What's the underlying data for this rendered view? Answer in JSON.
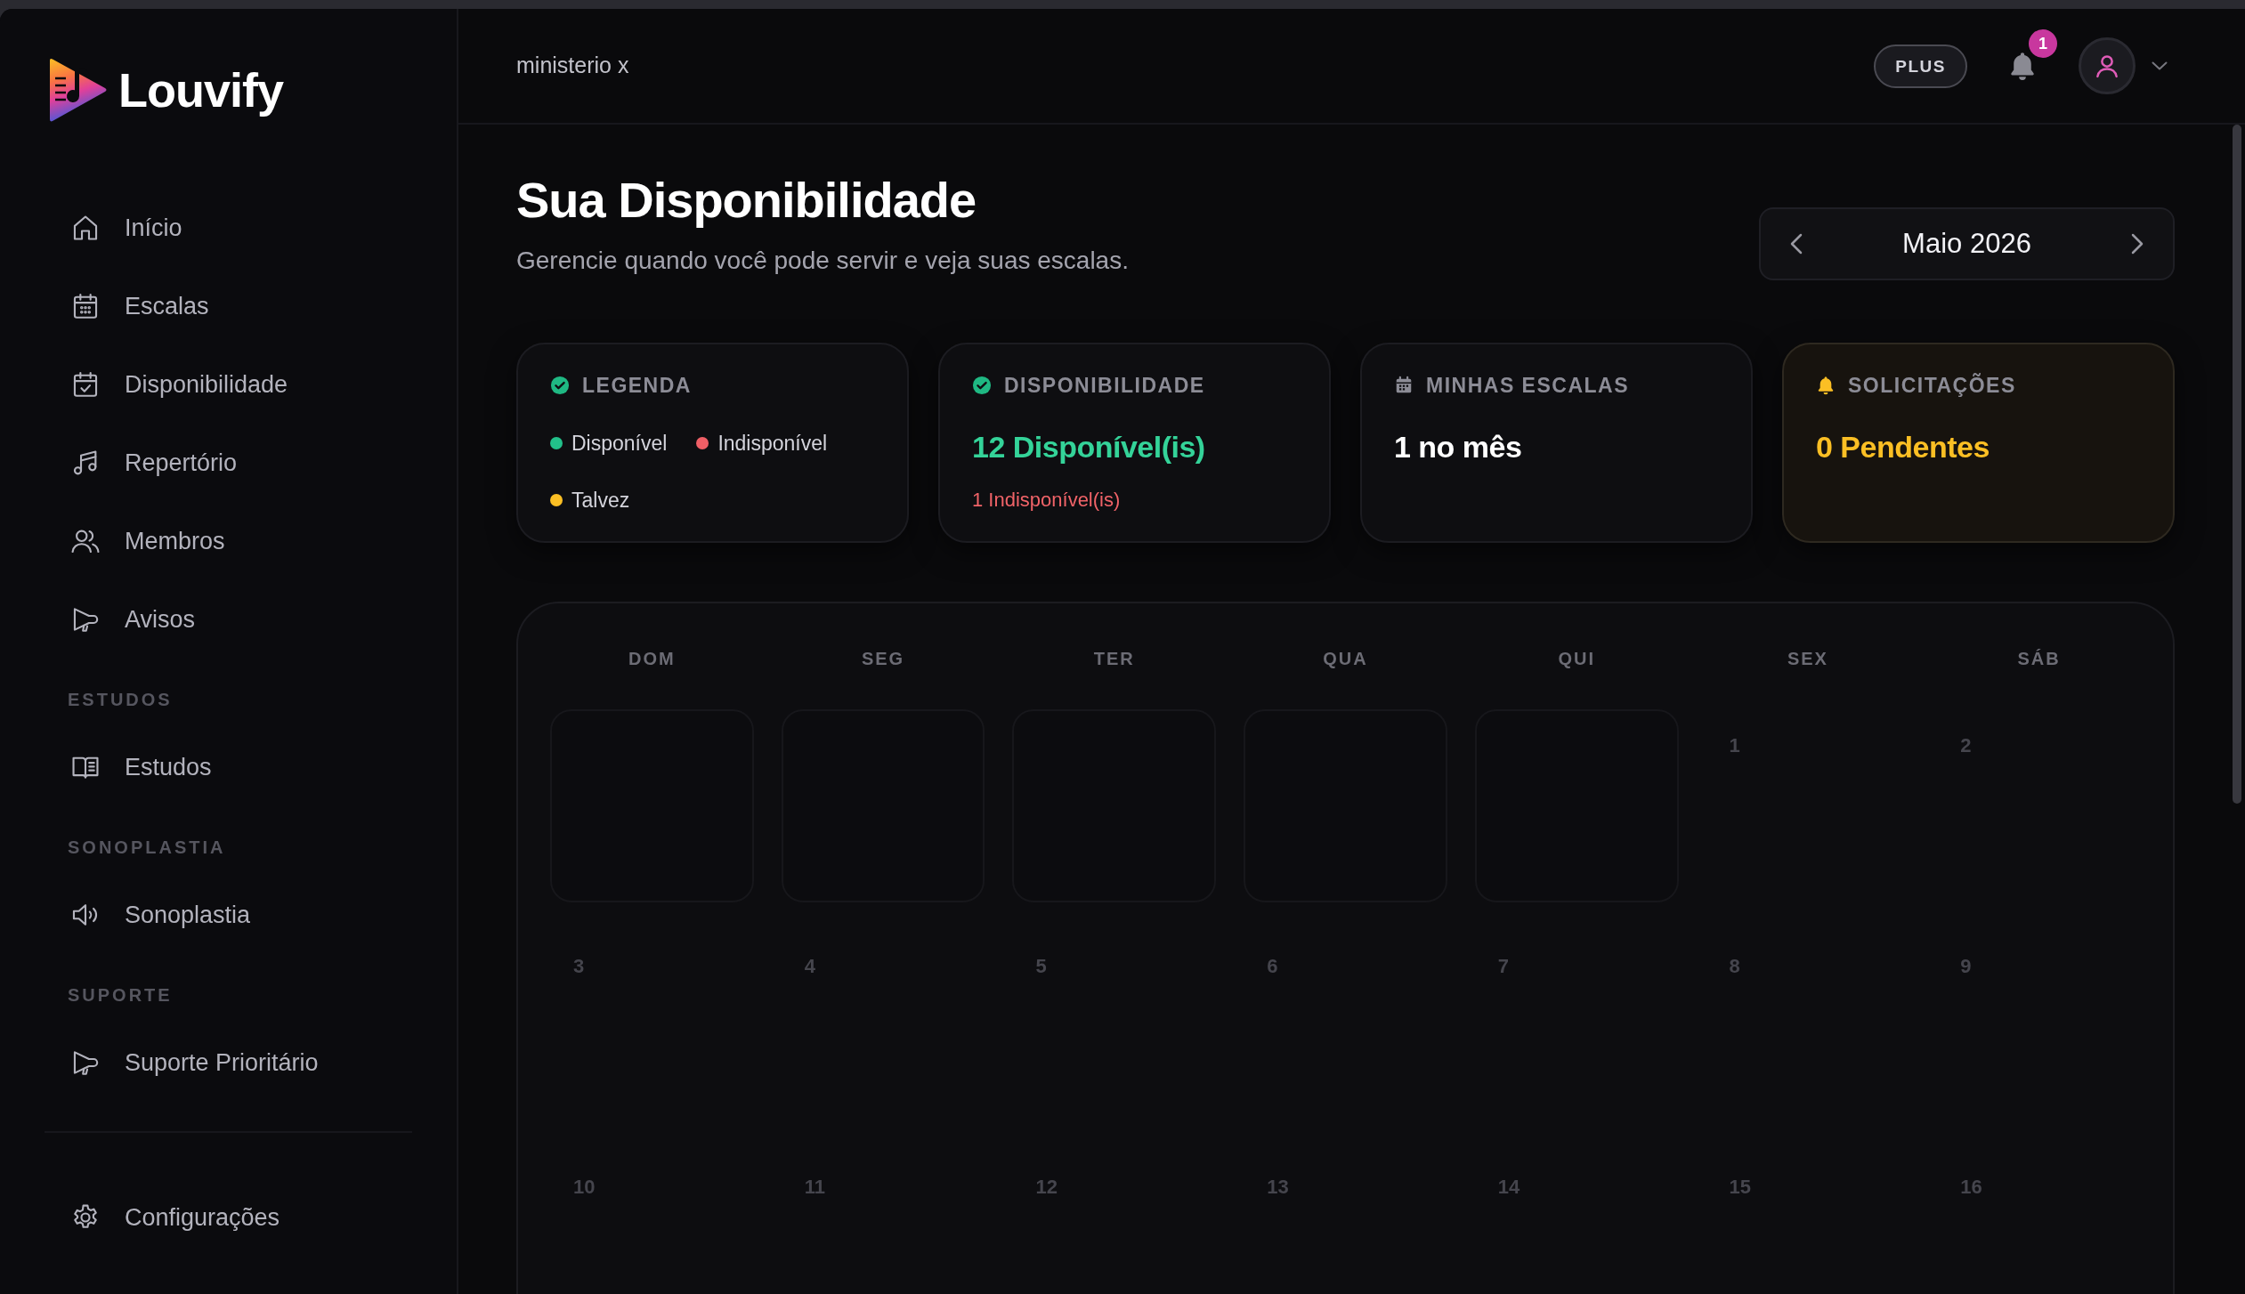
{
  "sidebar": {
    "brand": "Louvify",
    "groups": [
      {
        "items": [
          {
            "label": "Início"
          },
          {
            "label": "Escalas"
          },
          {
            "label": "Disponibilidade"
          },
          {
            "label": "Repertório"
          },
          {
            "label": "Membros"
          },
          {
            "label": "Avisos"
          }
        ]
      },
      {
        "heading": "ESTUDOS",
        "items": [
          {
            "label": "Estudos"
          }
        ]
      },
      {
        "heading": "SONOPLASTIA",
        "items": [
          {
            "label": "Sonoplastia"
          }
        ]
      },
      {
        "heading": "SUPORTE",
        "items": [
          {
            "label": "Suporte Prioritário"
          }
        ]
      }
    ],
    "footer_items": [
      {
        "label": "Configurações"
      }
    ]
  },
  "top_bar": {
    "workspace": "ministerio x",
    "plan_badge": "PLUS",
    "notification_count": "1"
  },
  "header": {
    "title": "Sua Disponibilidade",
    "subtitle": "Gerencie quando você pode servir e veja suas escalas.",
    "month": "Maio 2026"
  },
  "summary_cards": [
    {
      "kind": "legend",
      "title": "LEGENDA",
      "legend": [
        {
          "label": "Disponível",
          "color": "#22c08a"
        },
        {
          "label": "Indisponível",
          "color": "#ef5f66"
        },
        {
          "label": "Talvez",
          "color": "#fbbf24"
        }
      ]
    },
    {
      "kind": "availability",
      "title": "DISPONIBILIDADE",
      "value": "12 Disponível(is)",
      "note": "1 Indisponível(is)"
    },
    {
      "kind": "schedule",
      "title": "MINHAS ESCALAS",
      "value": "1 no mês"
    },
    {
      "kind": "requests",
      "title": "SOLICITAÇÕES",
      "value": "0 Pendentes"
    }
  ],
  "calendar": {
    "weekdays": [
      "DOM",
      "SEG",
      "TER",
      "QUA",
      "QUI",
      "SEX",
      "SÁB"
    ],
    "cells": [
      {
        "kind": "blank"
      },
      {
        "kind": "blank"
      },
      {
        "kind": "blank"
      },
      {
        "kind": "blank"
      },
      {
        "kind": "blank"
      },
      {
        "kind": "day",
        "day": "1"
      },
      {
        "kind": "day",
        "day": "2"
      },
      {
        "kind": "day",
        "day": "3"
      },
      {
        "kind": "day",
        "day": "4"
      },
      {
        "kind": "day",
        "day": "5"
      },
      {
        "kind": "day",
        "day": "6"
      },
      {
        "kind": "day",
        "day": "7"
      },
      {
        "kind": "day",
        "day": "8"
      },
      {
        "kind": "day",
        "day": "9"
      },
      {
        "kind": "day",
        "day": "10"
      },
      {
        "kind": "day",
        "day": "11"
      },
      {
        "kind": "day",
        "day": "12"
      },
      {
        "kind": "day",
        "day": "13"
      },
      {
        "kind": "day",
        "day": "14"
      },
      {
        "kind": "day",
        "day": "15"
      },
      {
        "kind": "day",
        "day": "16"
      }
    ]
  }
}
